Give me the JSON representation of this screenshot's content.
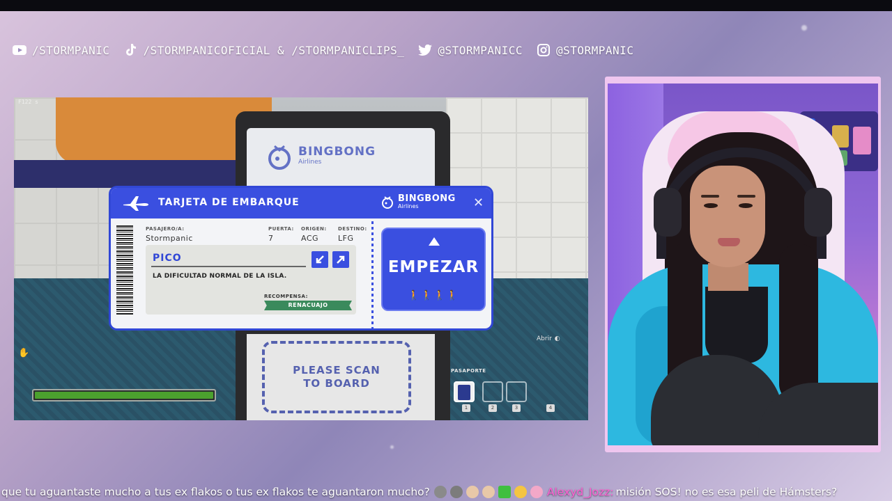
{
  "socials": {
    "youtube": "/STORMPANIC",
    "tiktok": "/STORMPANICOFICIAL & /STORMPANICLIPS_",
    "twitter": "@STORMPANICC",
    "instagram": "@STORMPANIC"
  },
  "game": {
    "fps": "F122 s",
    "kiosk_brand": "BINGBONG",
    "kiosk_brand_sub": "Airlines",
    "scan_text_1": "PLEASE SCAN",
    "scan_text_2": "TO BOARD",
    "health_percent": 100,
    "abrir_label": "Abrir",
    "passport_label": "PASAPORTE",
    "slot_numbers": [
      "1",
      "2",
      "3",
      "4"
    ]
  },
  "boarding_card": {
    "title": "TARJETA DE EMBARQUE",
    "brand": "BINGBONG",
    "brand_sub": "Airlines",
    "close_glyph": "✕",
    "passenger_label": "PASAJERO/A:",
    "passenger_value": "Stormpanic",
    "gate_label": "PUERTA:",
    "gate_value": "7",
    "origin_label": "ORIGEN:",
    "origin_value": "ACG",
    "destination_label": "DESTINO:",
    "destination_value": "LFG",
    "difficulty_name": "PICO",
    "difficulty_desc": "LA DIFICULTAD NORMAL DE LA ISLA.",
    "reward_label": "RECOMPENSA:",
    "reward_value": "RENACUAJO",
    "start_label": "EMPEZAR",
    "start_people": "🚶🚶🚶🚶"
  },
  "chat": {
    "message_1": "que tu aguantaste mucho a tus ex flakos o tus ex flakos te aguantaron mucho?",
    "user_2": "Alexyd_Jozz:",
    "message_2": "misión SOS! no es esa peli de Hámsters?"
  },
  "colors": {
    "accent": "#3a4fe0",
    "reward": "#3a8a5c",
    "chat_user": "#ff5fd2",
    "health": "#4ba12e"
  }
}
